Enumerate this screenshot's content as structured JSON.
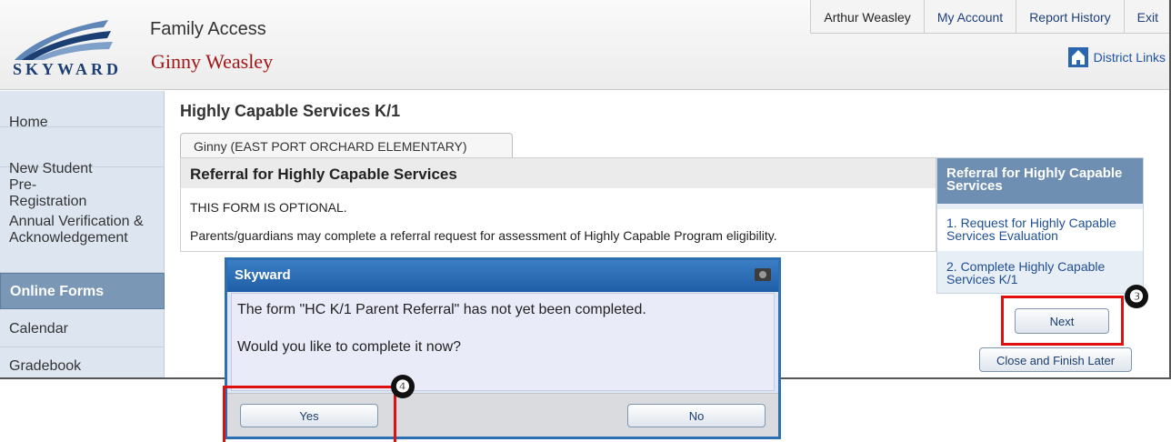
{
  "header": {
    "logo_text": "SKYWARD",
    "app_name": "Family Access",
    "student_name": "Ginny Weasley",
    "top_nav": [
      "Arthur Weasley",
      "My Account",
      "Report History",
      "Exit"
    ],
    "district_links": "District Links"
  },
  "sidebar": {
    "items": [
      {
        "label": "Home"
      },
      {
        "label": "New Student Pre-Registration"
      },
      {
        "label": "Annual Verification & Acknowledgement"
      },
      {
        "label": "Online Forms"
      },
      {
        "label": "Calendar"
      },
      {
        "label": "Gradebook"
      }
    ],
    "active_label": "Online Forms"
  },
  "main": {
    "page_title": "Highly Capable Services K/1",
    "student_tab": "Ginny (EAST PORT ORCHARD ELEMENTARY)",
    "form_heading": "Referral for Highly Capable Services",
    "optional_text": "THIS FORM IS OPTIONAL.",
    "description": "Parents/guardians may complete a referral request for assessment of Highly Capable Program eligibility."
  },
  "steps": {
    "header": "Referral for Highly Capable Services",
    "items": [
      {
        "label": "1. Request for Highly Capable Services Evaluation"
      },
      {
        "label": "2. Complete Highly Capable Services K/1"
      }
    ],
    "next_label": "Next",
    "close_later_label": "Close and Finish Later"
  },
  "dialog": {
    "title": "Skyward",
    "message": "The form \"HC K/1 Parent Referral\" has not yet been completed.",
    "question": "Would you like to complete it now?",
    "yes_label": "Yes",
    "no_label": "No"
  },
  "callouts": {
    "next_step_number": "❸",
    "yes_step_number": "❹"
  },
  "colors": {
    "accent": "#2c6fb2",
    "active_nav": "#7b97b6",
    "highlight": "#e01010",
    "student_name": "#a01717"
  }
}
